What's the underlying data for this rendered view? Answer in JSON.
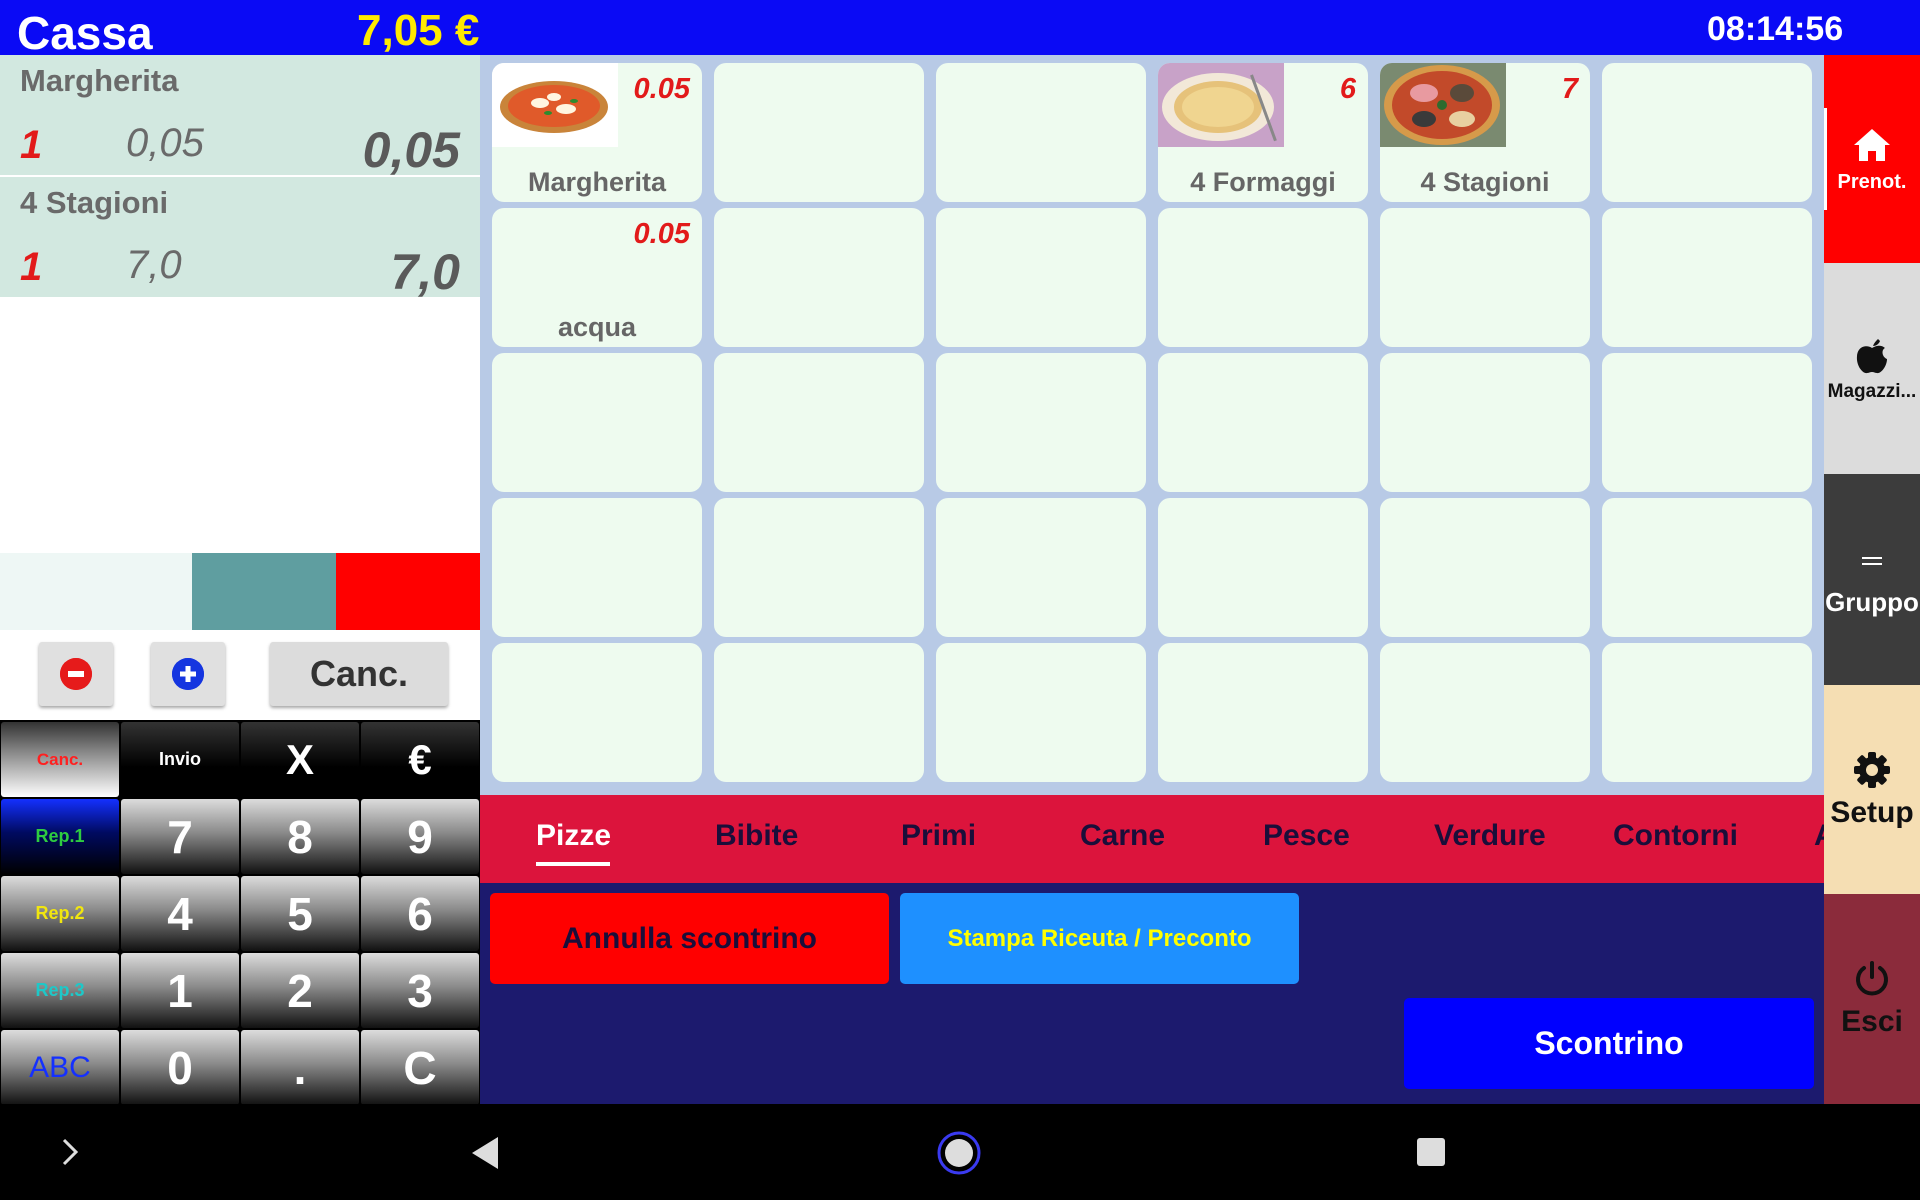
{
  "header": {
    "title": "Cassa",
    "total": "7,05 €",
    "clock": "08:14:56"
  },
  "receipt": {
    "lines": [
      {
        "name": "Margherita",
        "qty": "1",
        "price": "0,05",
        "amount": "0,05"
      },
      {
        "name": "4 Stagioni",
        "qty": "1",
        "price": "7,0",
        "amount": "7,0"
      }
    ]
  },
  "controls": {
    "minus_icon": "minus-circle-icon",
    "plus_icon": "plus-circle-icon",
    "cancel_label": "Canc."
  },
  "keypad": {
    "row1": [
      "Canc.",
      "Invio",
      "X",
      "€"
    ],
    "row2": [
      "Rep.1",
      "7",
      "8",
      "9"
    ],
    "row3": [
      "Rep.2",
      "4",
      "5",
      "6"
    ],
    "row4": [
      "Rep.3",
      "1",
      "2",
      "3"
    ],
    "row5": [
      "ABC",
      "0",
      ".",
      "C"
    ],
    "colors": {
      "canc": "#ff2020",
      "rep1": "#2ecc40",
      "rep2": "#f1e60f",
      "rep3": "#1ec8c8",
      "abc": "#1430ff"
    }
  },
  "products": [
    {
      "name": "Margherita",
      "price": "0.05",
      "image": "pizza-margherita"
    },
    {
      "name": "",
      "price": ""
    },
    {
      "name": "",
      "price": ""
    },
    {
      "name": "4 Formaggi",
      "price": "6",
      "image": "pizza-4-formaggi"
    },
    {
      "name": "4 Stagioni",
      "price": "7",
      "image": "pizza-4-stagioni"
    },
    {
      "name": "",
      "price": ""
    },
    {
      "name": "acqua",
      "price": "0.05"
    }
  ],
  "categories": {
    "active": "Pizze",
    "tabs": [
      "Pizze",
      "Bibite",
      "Primi",
      "Carne",
      "Pesce",
      "Verdure",
      "Contorni",
      "A"
    ]
  },
  "actions": {
    "annulla": "Annulla scontrino",
    "stampa": "Stampa Riceuta / Preconto",
    "scontrino": "Scontrino"
  },
  "sidebar": {
    "items": [
      {
        "label": "Prenot.",
        "icon": "home-icon"
      },
      {
        "label": "Magazzi...",
        "icon": "apple-icon"
      },
      {
        "label": "Gruppo",
        "icon": "equals-icon"
      },
      {
        "label": "Setup",
        "icon": "gear-icon"
      },
      {
        "label": "Esci",
        "icon": "power-icon"
      }
    ]
  },
  "navbar": {
    "icons": [
      "chevron-right-icon",
      "back-icon",
      "home-circle-icon",
      "recents-icon"
    ]
  },
  "colors": {
    "topbar": "#0a0af5",
    "total_text": "#ffea00",
    "receipt_row": "#d2e8e0",
    "grid_bg": "#b8cae6",
    "tile_bg": "#eefbef",
    "category_bar": "#dc143c",
    "action_area": "#1c1a6e"
  }
}
